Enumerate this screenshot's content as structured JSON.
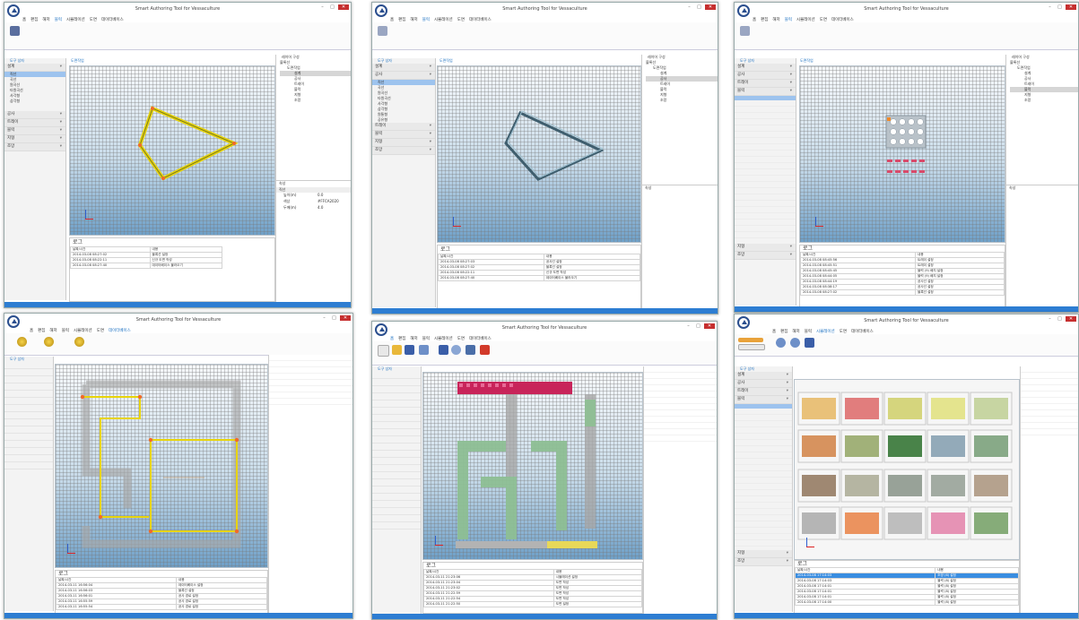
{
  "app": {
    "window_title": "Smart Authoring Tool for Vessaculture",
    "window_buttons": [
      "–",
      "□",
      "✕"
    ],
    "menu": [
      "홈",
      "편집",
      "해저",
      "블럭",
      "시뮬레이션",
      "도면",
      "데이터베이스"
    ]
  },
  "common": {
    "left_header": "도구 상자",
    "canvas_tab": "도면작업",
    "layer_header": "레이어 구성",
    "prop_header": "속성",
    "log_title": "로그",
    "log_col_time": "날짜/시간",
    "log_col_desc": "내용"
  },
  "panel1": {
    "left_sections": [
      "설계",
      "공사",
      "트레이",
      "블럭",
      "지형",
      "조망"
    ],
    "left_items": [
      "직선",
      "곡선",
      "원곡선",
      "타원곡선",
      "사각형",
      "삼각형"
    ],
    "tree_root": "블록선",
    "tree_group": "도면작업",
    "tree_items": [
      "설계",
      "공사",
      "트레이",
      "블럭",
      "지형",
      "조망"
    ],
    "props": {
      "label": "직선",
      "row1_key": "높이(m)",
      "row1_val": "0.0",
      "row2_key": "색상",
      "row2_val": "#FFCA2020",
      "row3_key": "두께(m)",
      "row3_val": "4.0"
    },
    "log_rows": [
      [
        "2014-03-08 08:27:02",
        "블록선 설정"
      ],
      [
        "2014-03-08 08:22:11",
        "신규 도면 작성"
      ],
      [
        "2014-03-08 08:27:40",
        "데이터베이스 불러오기"
      ]
    ]
  },
  "panel2": {
    "left_sections": [
      "설계",
      "공사",
      "트레이",
      "블럭",
      "지형",
      "조망"
    ],
    "left_items": [
      "직선",
      "곡선",
      "원곡선",
      "타원곡선",
      "사각형",
      "삼각형",
      "원통형",
      "공유형"
    ],
    "tree_root": "블록선",
    "tree_group": "도면작업",
    "tree_items": [
      "설계",
      "공사",
      "트레이",
      "블럭",
      "지형",
      "조망"
    ],
    "log_rows": [
      [
        "2014-03-08 08:27:03",
        "공사선 설정"
      ],
      [
        "2014-03-08 08:27:02",
        "블록선 설정"
      ],
      [
        "2014-03-08 08:22:11",
        "신규 도면 작성"
      ],
      [
        "2014-03-08 08:27:40",
        "데이터베이스 불러오기"
      ]
    ]
  },
  "panel3": {
    "left_sections": [
      "설계",
      "공사",
      "트레이",
      "블럭",
      "지형",
      "조망"
    ],
    "tree_root": "블록선",
    "tree_group": "도면작업",
    "tree_items": [
      "설계",
      "공사",
      "트레이",
      "블럭",
      "지형",
      "조망"
    ],
    "log_rows": [
      [
        "2014-03-08 08:45:56",
        "트레이 설정"
      ],
      [
        "2014-03-08 08:45:51",
        "트레이 설정"
      ],
      [
        "2014-03-08 08:45:45",
        "블럭 (9) 배치 설정"
      ],
      [
        "2014-03-08 08:44:05",
        "블럭 (9) 배치 설정"
      ],
      [
        "2014-03-08 08:44:19",
        "공사선 설정"
      ],
      [
        "2014-03-08 08:38:17",
        "공사선 설정"
      ],
      [
        "2014-03-08 08:27:02",
        "블록선 설정"
      ]
    ]
  },
  "panel4": {
    "log_rows": [
      [
        "2014-03-11 16:56:04",
        "데이터베이스 설정"
      ],
      [
        "2014-03-11 16:56:03",
        "블록선 설정"
      ],
      [
        "2014-03-11 16:56:01",
        "공사 경로 설정"
      ],
      [
        "2014-03-11 16:55:59",
        "공사 경로 설정"
      ],
      [
        "2014-03-11 16:55:54",
        "공사 경로 설정"
      ]
    ]
  },
  "panel5": {
    "log_rows": [
      [
        "2014-03-11 21:23:06",
        "시뮬레이션 설정"
      ],
      [
        "2014-03-11 21:23:04",
        "도면 작성"
      ],
      [
        "2014-03-11 21:23:02",
        "도면 작성"
      ],
      [
        "2014-03-11 21:22:59",
        "도면 작성"
      ],
      [
        "2014-03-11 21:22:54",
        "도면 작성"
      ],
      [
        "2014-03-11 21:22:50",
        "도면 설정"
      ]
    ]
  },
  "panel6": {
    "left_sections": [
      "설계",
      "공사",
      "트레이",
      "블럭",
      "지형",
      "조망"
    ],
    "log_rows": [
      [
        "2014-03-08 17:14:03",
        "조망 (6) 설정"
      ],
      [
        "2014-03-08 17:14:03",
        "블럭 (8) 설정"
      ],
      [
        "2014-03-08 17:14:01",
        "블럭 (8) 설정"
      ],
      [
        "2014-03-08 17:14:01",
        "블럭 (8) 설정"
      ],
      [
        "2014-03-08 17:14:01",
        "블럭 (8) 설정"
      ],
      [
        "2014-03-08 17:14:00",
        "블럭 (8) 설정"
      ]
    ]
  },
  "colors": {
    "accent": "#2d7dd2",
    "selection": "#9dc3ee",
    "close": "#c62f2f",
    "path": "#e8d40a"
  }
}
